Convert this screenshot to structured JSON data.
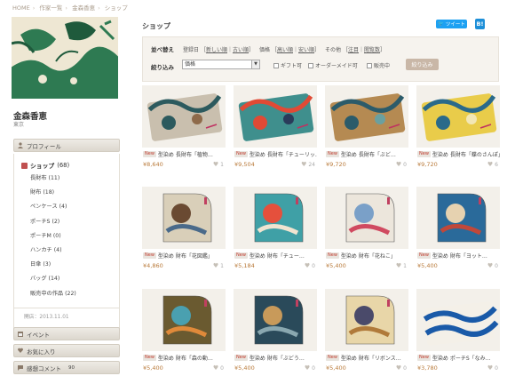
{
  "breadcrumb": [
    "HOME",
    "作家一覧",
    "金森香恵",
    "ショップ"
  ],
  "sidebar": {
    "artist_name": "金森香恵",
    "location": "東京",
    "profile_label": "プロフィール",
    "shop_label": "ショップ",
    "shop_count": "(68)",
    "categories": [
      "長財布 (11)",
      "財布 (18)",
      "ペンケース (4)",
      "ポーチS (2)",
      "ポーチM (0)",
      "ハンカチ (4)",
      "日傘 (3)",
      "バッグ (14)",
      "販売中の作品 (22)"
    ],
    "opened": "開店：2013.11.01",
    "event_label": "イベント",
    "favorite_label": "お気に入り",
    "comment_label": "感想コメント",
    "comment_count": "90"
  },
  "main": {
    "title": "ショップ",
    "tweet_label": "ツイート",
    "hatena_label": "B!",
    "sort_label": "並べ替え",
    "sort_groups": [
      {
        "name": "登録日",
        "opts": [
          "新しい順",
          "古い順"
        ]
      },
      {
        "name": "価格",
        "opts": [
          "高い順",
          "安い順"
        ]
      },
      {
        "name": "その他",
        "opts": [
          "注目",
          "閲覧数"
        ]
      }
    ],
    "filter_label": "絞り込み",
    "filter_select": "価格",
    "checks": [
      "ギフト可",
      "オーダーメイド可",
      "販売中"
    ],
    "filter_button": "絞り込み"
  },
  "products": [
    {
      "new": "New",
      "title": "型染め 長財布「植物…",
      "price": "¥8,640",
      "likes": "1",
      "palette": [
        "#c9bfae",
        "#2c5a5e",
        "#8e6a4a"
      ]
    },
    {
      "new": "New",
      "title": "型染め 長財布「チューリッ…",
      "price": "¥9,504",
      "likes": "24",
      "palette": [
        "#3f8f8d",
        "#e04a35",
        "#2a3b5a"
      ]
    },
    {
      "new": "New",
      "title": "型染め 長財布「ぶど…",
      "price": "¥9,720",
      "likes": "0",
      "palette": [
        "#b58a52",
        "#2b5b6a",
        "#6aa0a0"
      ]
    },
    {
      "new": "New",
      "title": "型染め 長財布「蝶のさんぽ」",
      "price": "¥9,720",
      "likes": "6",
      "palette": [
        "#e9cc4a",
        "#2a6a8a",
        "#f2e7b5"
      ]
    },
    {
      "new": "New",
      "title": "型染め 財布「花図鑑」",
      "price": "¥4,860",
      "likes": "1",
      "palette": [
        "#d9cfb9",
        "#6a4a32",
        "#4a6a8a"
      ]
    },
    {
      "new": "New",
      "title": "型染め 財布「チュー…",
      "price": "¥5,184",
      "likes": "0",
      "palette": [
        "#3fa0a6",
        "#e5503c",
        "#f0e4d0"
      ]
    },
    {
      "new": "New",
      "title": "型染め 財布「花ねこ」",
      "price": "¥5,400",
      "likes": "1",
      "palette": [
        "#ece6dc",
        "#7aa0c8",
        "#d04a60"
      ]
    },
    {
      "new": "New",
      "title": "型染め 財布「ヨット…",
      "price": "¥5,400",
      "likes": "0",
      "palette": [
        "#2a6a9a",
        "#e6d2b0",
        "#c0483a"
      ]
    },
    {
      "new": "New",
      "title": "型染め 財布「森の動…",
      "price": "¥5,400",
      "likes": "0",
      "palette": [
        "#6a5a30",
        "#4aa0b0",
        "#e08a3a"
      ]
    },
    {
      "new": "New",
      "title": "型染め 財布「ぶどう…",
      "price": "¥5,400",
      "likes": "0",
      "palette": [
        "#2a4a5a",
        "#c89a5a",
        "#8aa8b0"
      ]
    },
    {
      "new": "New",
      "title": "型染め 財布「リボンス…",
      "price": "¥5,400",
      "likes": "0",
      "palette": [
        "#e8d6a8",
        "#4a4a6a",
        "#b07a3a"
      ]
    },
    {
      "new": "New",
      "title": "型染め ポーチS「なみ…",
      "price": "¥3,780",
      "likes": "0",
      "palette": [
        "#1a5aa8",
        "#f4f0e8",
        "#c0c8d8"
      ]
    }
  ]
}
